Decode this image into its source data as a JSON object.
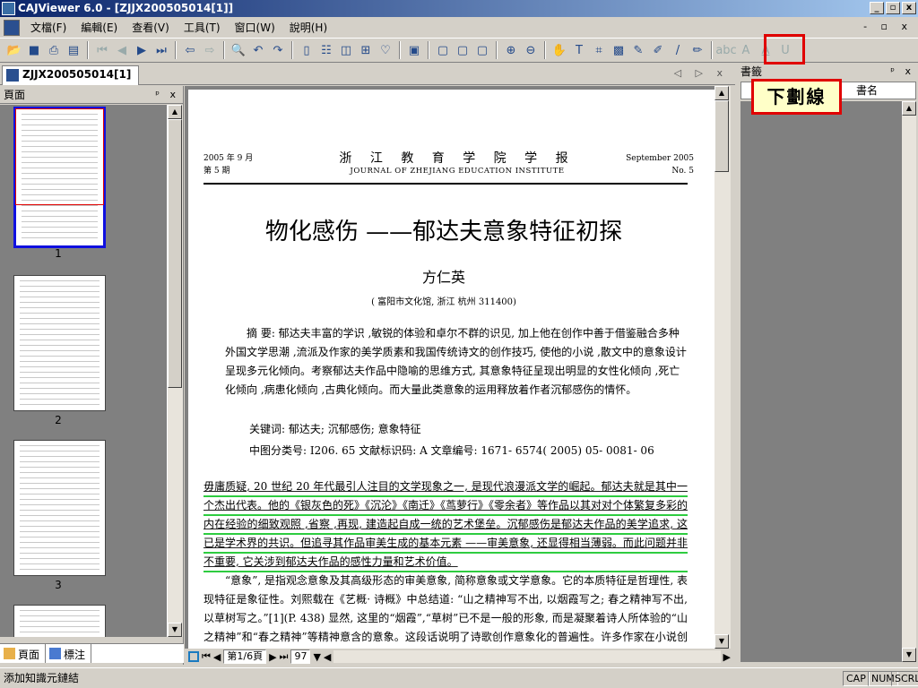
{
  "window": {
    "title": "CAJViewer 6.0 - [ZJJX200505014[1]]",
    "controls": [
      "_",
      "▫",
      "x"
    ]
  },
  "menu": {
    "items": [
      "文檔(F)",
      "編輯(E)",
      "查看(V)",
      "工具(T)",
      "窗口(W)",
      "說明(H)"
    ],
    "mdi_controls": "- ▫ x"
  },
  "toolbar": {
    "icons": [
      "open-icon",
      "save-icon",
      "print-icon",
      "print-setup-icon",
      "first-page-icon",
      "prev-page-icon",
      "next-page-icon",
      "last-page-icon",
      "back-icon",
      "forward-icon",
      "search-icon",
      "undo-icon",
      "redo-icon",
      "single-page-icon",
      "continuous-icon",
      "facing-icon",
      "fit-icon",
      "snapshot-icon",
      "layout-1-icon",
      "layout-2-icon",
      "layout-3-icon",
      "zoom-in-icon",
      "zoom-out-icon",
      "hand-icon",
      "text-select-icon",
      "area-select-icon",
      "image-select-icon",
      "ocr-icon",
      "highlight-icon",
      "pen-icon",
      "marker-icon",
      "strikethrough-icon",
      "underline-icon",
      "text-annotation-icon",
      "note-icon"
    ]
  },
  "doc_tab": {
    "label": "ZJJX200505014[1]",
    "nav": "◁ ▷ x"
  },
  "left_panel": {
    "header": "頁面",
    "pin": "ᵖ x",
    "thumb_numbers": [
      "1",
      "2",
      "3"
    ],
    "tabs": [
      "頁面",
      "標注"
    ]
  },
  "right_panel": {
    "header": "書籤",
    "pin": "ᵖ x",
    "combo_value": "書名"
  },
  "callout": {
    "label": "下劃線"
  },
  "page": {
    "header_left": [
      "2005 年 9 月",
      "第 5 期"
    ],
    "header_center_cn": "浙 江 教 育 学 院 学 报",
    "header_center_en": "JOURNAL OF ZHEJIANG EDUCATION INSTITUTE",
    "header_right": [
      "September 2005",
      "No. 5"
    ],
    "title": "物化感伤 ——郁达夫意象特征初探",
    "author": "方仁英",
    "affiliation": "( 富阳市文化馆, 浙江  杭州  311400)",
    "abstract": "摘  要: 郁达夫丰富的学识 ,敏锐的体验和卓尔不群的识见, 加上他在创作中善于借鉴融合多种外国文学思潮 ,流派及作家的美学质素和我国传统诗文的创作技巧, 使他的小说 ,散文中的意象设计呈现多元化倾向。考察郁达夫作品中隐喻的思维方式, 其意象特征呈现出明显的女性化倾向 ,死亡化倾向 ,病患化倾向 ,古典化倾向。而大量此类意象的运用释放着作者沉郁感伤的情怀。",
    "keywords": "关键词: 郁达夫; 沉郁感伤; 意象特征",
    "classification": "中图分类号: I206. 65    文献标识码: A    文章编号: 1671- 6574( 2005) 05- 0081- 06",
    "body_highlighted": "毋庸质疑, 20 世纪 20 年代最引人注目的文学现象之一, 是现代浪漫派文学的崛起。郁达夫就是其中一个杰出代表。他的《银灰色的死》《沉沦》《南迁》《茑萝行》《零余者》等作品以其对对个体繁复多彩的内在经验的细致观照 ,省察 ,再现, 建造起自成一统的艺术堡垒。沉郁感伤是郁达夫作品的美学追求, 这已是学术界的共识。但追寻其作品审美生成的基本元素 ——审美意象, 还显得相当薄弱。而此问题并非不重要, 它关涉到郁达夫作品的感性力量和艺术价值。",
    "body_rest": "“意象”, 是指观念意象及其高级形态的审美意象, 简称意象或文学意象。它的本质特征是哲理性, 表现特征是象征性。刘熙载在《艺概· 诗概》中总结道: “山之精神写不出, 以烟霞写之; 春之精神写不出, 以草树写之。”[1](P. 438) 显然, 这里的“烟霞”,“草树”已不是一般的形象, 而是凝聚着诗人所体验的“山之精神”和“春之精神”等精神意含的意象。这段话说明了诗歌创作意象化的普遍性。许多作家在小说创作中也十分重视在讲述元的未完意象, 比如郭平邦, 夏志"
  },
  "doc_bottom": {
    "page_field": "第1/6頁",
    "zoom_field": "97"
  },
  "status": {
    "text": "添加知識元鏈結",
    "indicators": [
      "CAP",
      "NUM",
      "SCRL"
    ]
  }
}
